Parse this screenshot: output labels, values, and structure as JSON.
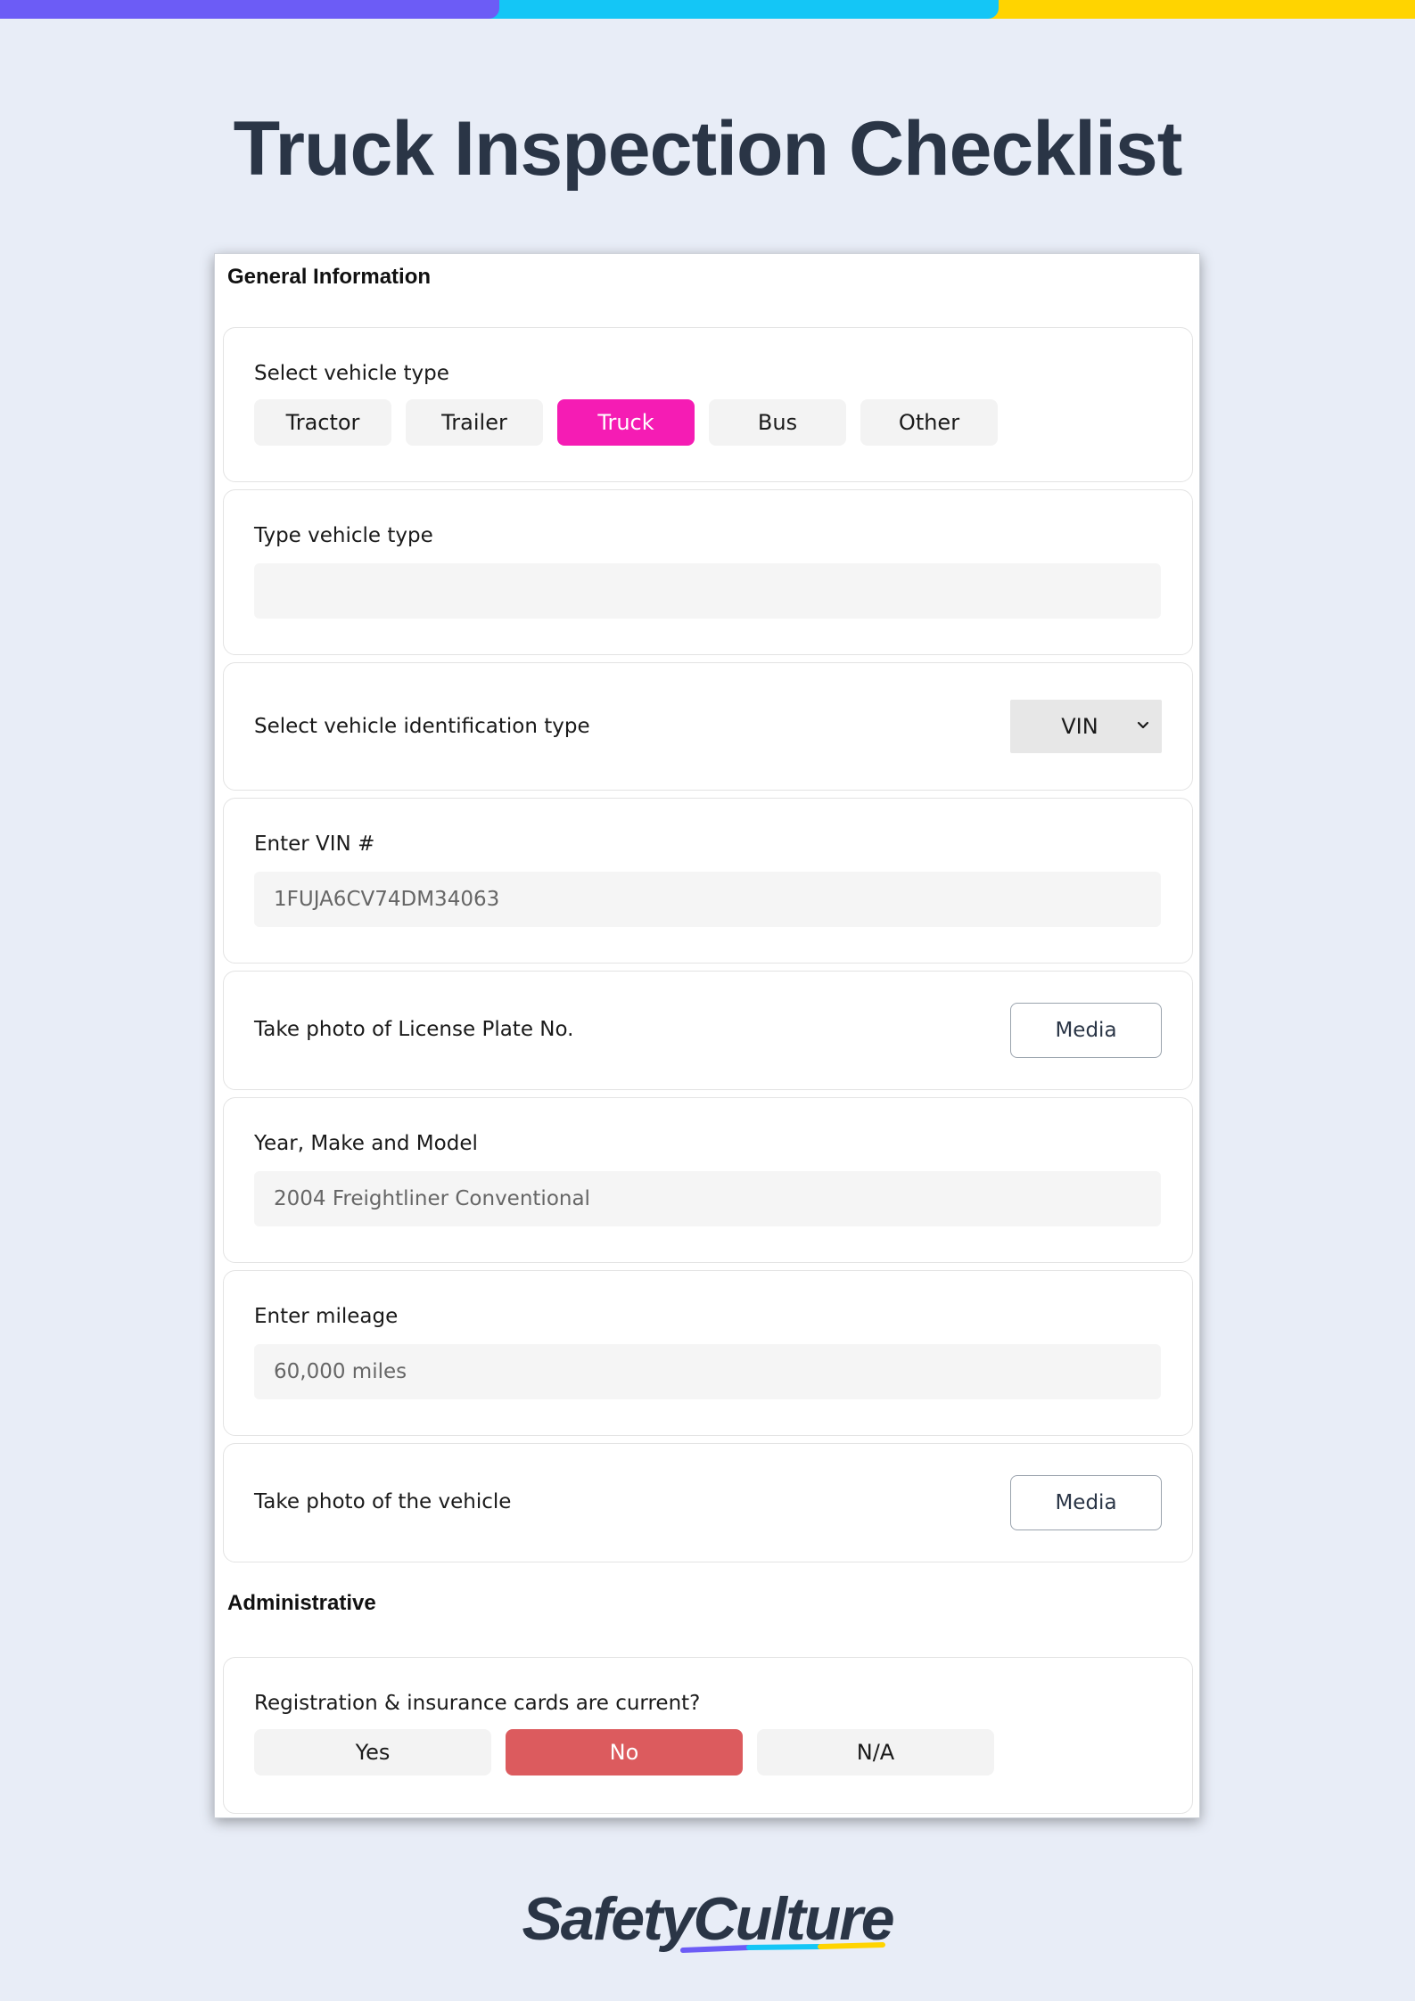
{
  "page": {
    "title": "Truck Inspection Checklist",
    "accent_colors": [
      "#6c5cf6",
      "#14c6f6",
      "#ffd400"
    ]
  },
  "sections": {
    "general": {
      "title": "General Information",
      "vehicle_type": {
        "label": "Select vehicle type",
        "options": [
          "Tractor",
          "Trailer",
          "Truck",
          "Bus",
          "Other"
        ],
        "selected": "Truck",
        "selected_color": "#f51cb4"
      },
      "type_vehicle": {
        "label": "Type vehicle type",
        "value": ""
      },
      "id_type": {
        "label": "Select vehicle identification type",
        "value": "VIN",
        "icon": "chevron-down-icon"
      },
      "vin": {
        "label": "Enter VIN #",
        "value": "1FUJA6CV74DM34063"
      },
      "license_photo": {
        "label": "Take photo of License Plate No.",
        "button": "Media"
      },
      "year_make_model": {
        "label": "Year, Make and Model",
        "value": "2004 Freightliner Conventional"
      },
      "mileage": {
        "label": "Enter mileage",
        "value": "60,000 miles"
      },
      "vehicle_photo": {
        "label": "Take photo of the vehicle",
        "button": "Media"
      }
    },
    "administrative": {
      "title": "Administrative",
      "registration": {
        "label": "Registration & insurance cards are current?",
        "options": [
          "Yes",
          "No",
          "N/A"
        ],
        "selected": "No",
        "selected_color": "#dc5b5e"
      }
    }
  },
  "footer": {
    "logo_text": "SafetyCulture"
  }
}
